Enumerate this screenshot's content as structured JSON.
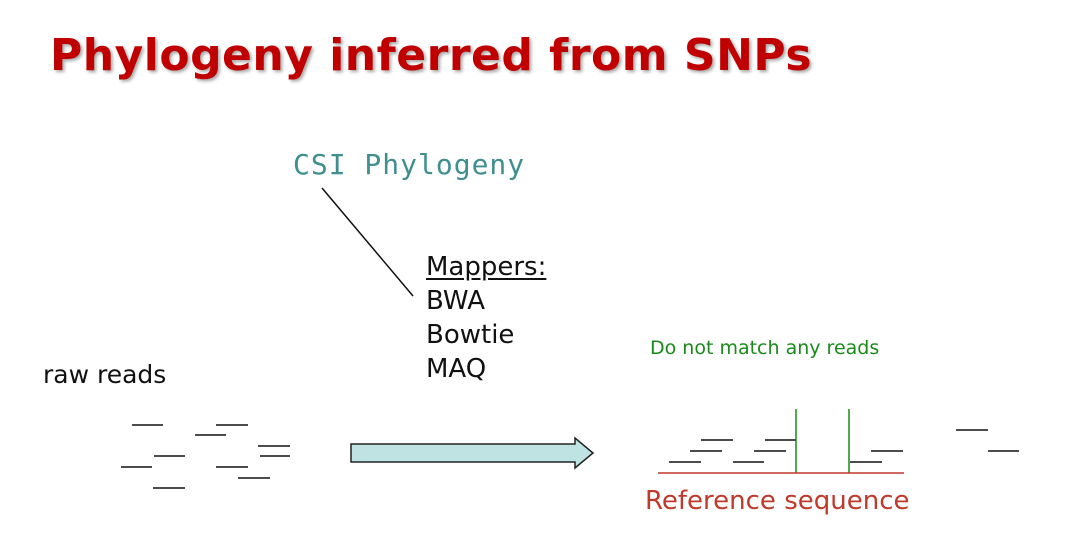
{
  "title": "Phylogeny inferred from SNPs",
  "tool_label": "CSI Phylogeny",
  "mappers": {
    "heading": "Mappers:",
    "items": [
      "BWA",
      "Bowtie",
      "MAQ"
    ]
  },
  "raw_reads_label": "raw reads",
  "no_match_label": "Do not match any reads",
  "reference_label": "Reference sequence",
  "colors": {
    "title": "#c00000",
    "tool_label": "#3f8f8f",
    "arrow_fill": "#bfe3e3",
    "no_match": "#1a8a1a",
    "reference": "#c0392b"
  }
}
